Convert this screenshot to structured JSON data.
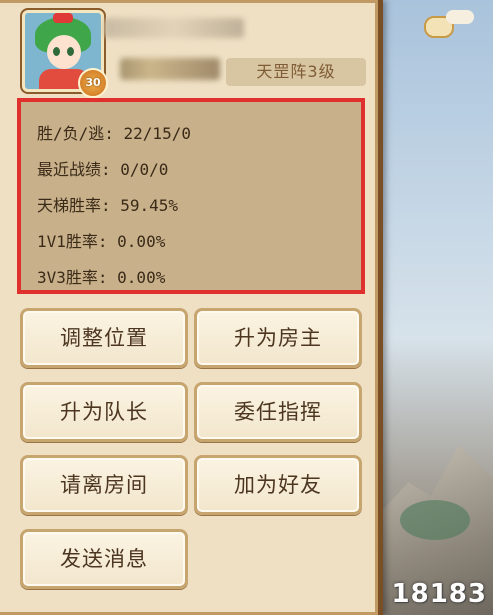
{
  "player": {
    "level": "30",
    "rank": "天罡阵3级"
  },
  "stats": [
    {
      "label": "胜/负/逃: 22/15/0"
    },
    {
      "label": "最近战绩: 0/0/0"
    },
    {
      "label": "天梯胜率: 59.45%"
    },
    {
      "label": "1V1胜率: 0.00%"
    },
    {
      "label": "3V3胜率: 0.00%"
    }
  ],
  "actions": {
    "adjust_position": "调整位置",
    "promote_owner": "升为房主",
    "promote_captain": "升为队长",
    "appoint_commander": "委任指挥",
    "kick_from_room": "请离房间",
    "add_friend": "加为好友",
    "send_message": "发送消息"
  },
  "watermark": "18183",
  "colors": {
    "highlight_border": "#e0302e",
    "panel_bg": "#efe0c4",
    "stats_bg": "#c8b08a",
    "button_text": "#4d3620"
  }
}
